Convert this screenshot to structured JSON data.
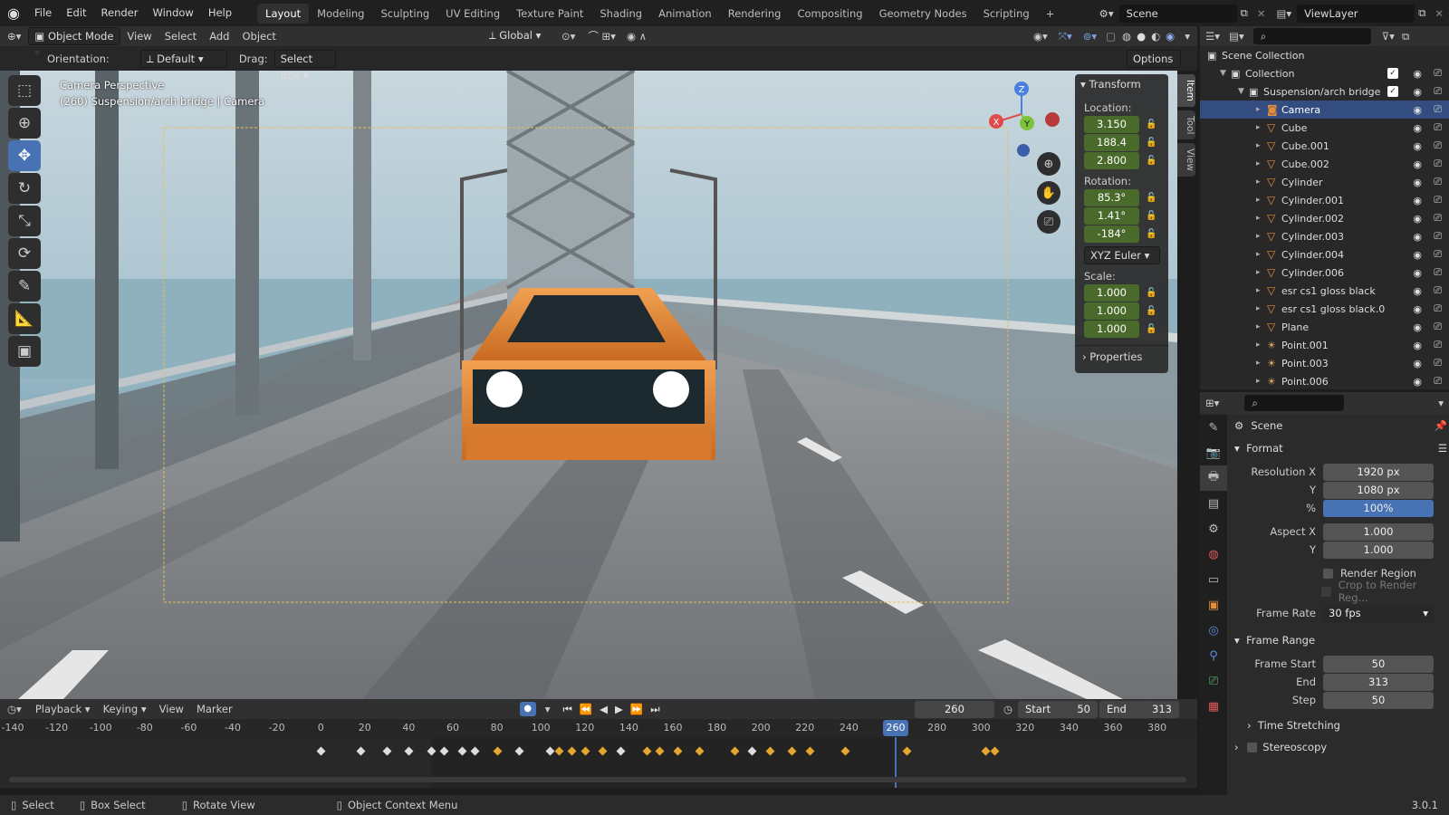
{
  "app": {
    "menus": [
      "File",
      "Edit",
      "Render",
      "Window",
      "Help"
    ],
    "workspaces": [
      "Layout",
      "Modeling",
      "Sculpting",
      "UV Editing",
      "Texture Paint",
      "Shading",
      "Animation",
      "Rendering",
      "Compositing",
      "Geometry Nodes",
      "Scripting",
      "+"
    ],
    "active_workspace": "Layout",
    "scene": "Scene",
    "view_layer": "ViewLayer"
  },
  "viewport_header": {
    "mode": "Object Mode",
    "menus": [
      "View",
      "Select",
      "Add",
      "Object"
    ],
    "transform_orientation": "Global"
  },
  "tool_settings": {
    "orientation_label": "Orientation:",
    "orientation": "Default",
    "drag_label": "Drag:",
    "drag": "Select Box",
    "options": "Options"
  },
  "overlay_text": {
    "line1": "Camera Perspective",
    "line2": "(260) Suspension/arch bridge | Camera"
  },
  "gizmo": {
    "z": "Z",
    "x": "X",
    "y": "Y"
  },
  "npanel": {
    "title": "Transform",
    "location_label": "Location:",
    "location": [
      "3.150",
      "188.4",
      "2.800"
    ],
    "rotation_label": "Rotation:",
    "rotation": [
      "85.3°",
      "1.41°",
      "-184°"
    ],
    "rotation_mode": "XYZ Euler",
    "scale_label": "Scale:",
    "scale": [
      "1.000",
      "1.000",
      "1.000"
    ],
    "properties": "Properties",
    "tabs": [
      "Item",
      "Tool",
      "View"
    ]
  },
  "outliner": {
    "scene_collection": "Scene Collection",
    "collection": "Collection",
    "group": "Suspension/arch bridge",
    "items": [
      "Camera",
      "Cube",
      "Cube.001",
      "Cube.002",
      "Cylinder",
      "Cylinder.001",
      "Cylinder.002",
      "Cylinder.003",
      "Cylinder.004",
      "Cylinder.006",
      "esr cs1 gloss black",
      "esr cs1 gloss black.0",
      "Plane",
      "Point.001",
      "Point.003",
      "Point.006"
    ]
  },
  "properties": {
    "context": "Scene",
    "format": {
      "title": "Format",
      "res_x_label": "Resolution X",
      "res_x": "1920 px",
      "y_label": "Y",
      "res_y": "1080 px",
      "pct_label": "%",
      "pct": "100%",
      "aspect_x_label": "Aspect X",
      "aspect_x": "1.000",
      "aspect_y": "1.000",
      "render_region": "Render Region",
      "crop": "Crop to Render Reg...",
      "frame_rate_label": "Frame Rate",
      "frame_rate": "30 fps"
    },
    "frame_range": {
      "title": "Frame Range",
      "start_label": "Frame Start",
      "start": "50",
      "end_label": "End",
      "end": "313",
      "step_label": "Step",
      "step": "50"
    },
    "time_stretching": "Time Stretching",
    "stereoscopy": "Stereoscopy"
  },
  "timeline": {
    "menus": [
      "Playback",
      "Keying",
      "View",
      "Marker"
    ],
    "current": "260",
    "start_label": "Start",
    "start": "50",
    "end_label": "End",
    "end": "313",
    "ticks": [
      "-140",
      "-120",
      "-100",
      "-80",
      "-60",
      "-40",
      "-20",
      "0",
      "20",
      "40",
      "60",
      "80",
      "100",
      "120",
      "140",
      "160",
      "180",
      "200",
      "220",
      "240",
      "260",
      "280",
      "300",
      "320",
      "340",
      "360",
      "380"
    ]
  },
  "status": {
    "select": "Select",
    "box_select": "Box Select",
    "rotate": "Rotate View",
    "context_menu": "Object Context Menu",
    "version": "3.0.1"
  }
}
